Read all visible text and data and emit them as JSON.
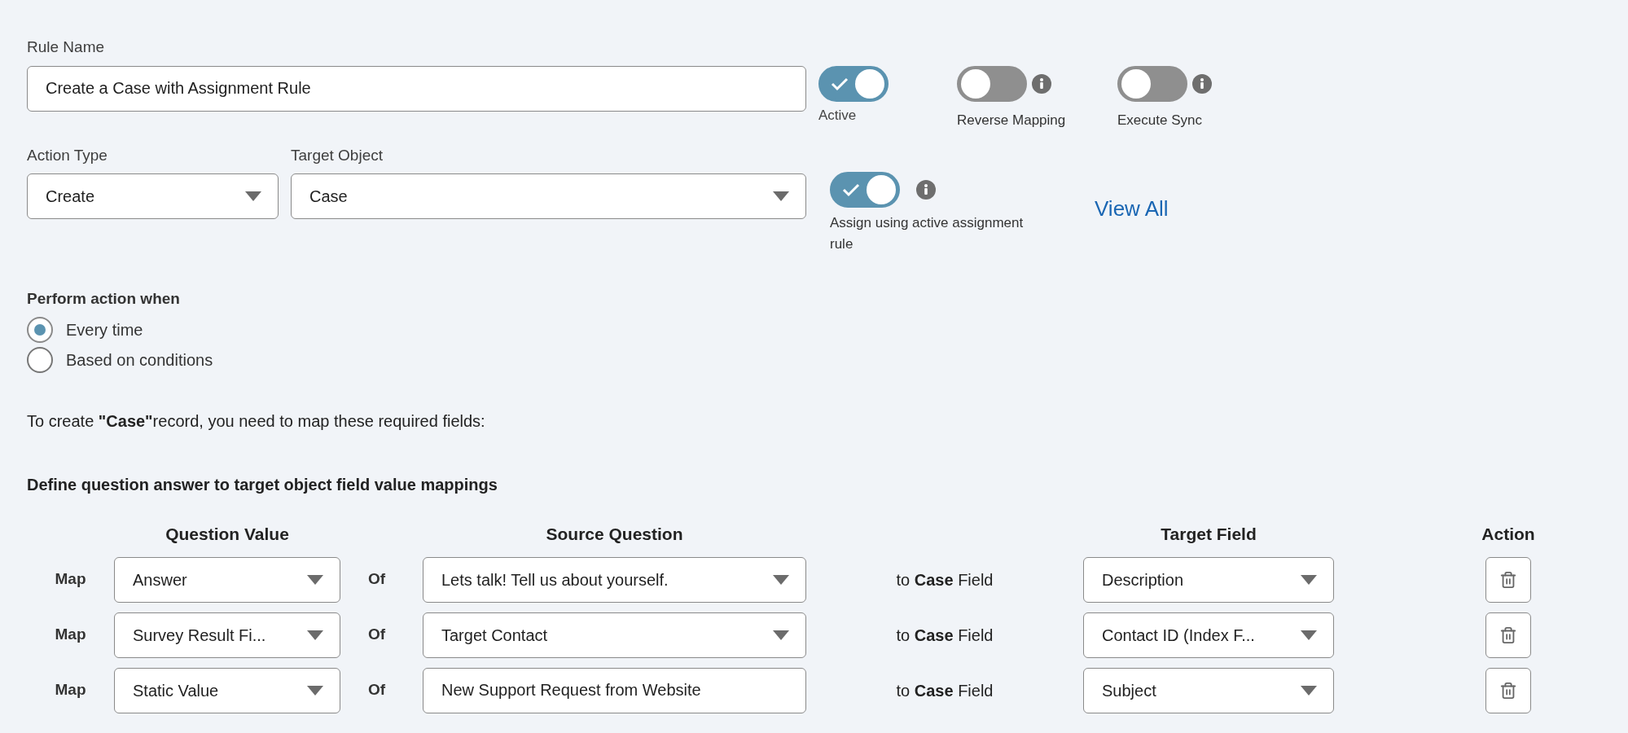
{
  "rule_name": {
    "label": "Rule Name",
    "value": "Create a Case with Assignment Rule"
  },
  "toggles": [
    {
      "label": "Active",
      "on": true,
      "info": false
    },
    {
      "label": "Reverse Mapping",
      "on": false,
      "info": true
    },
    {
      "label": "Execute Sync",
      "on": false,
      "info": true
    }
  ],
  "action_type": {
    "label": "Action Type",
    "value": "Create"
  },
  "target_object": {
    "label": "Target Object",
    "value": "Case"
  },
  "assign_toggle": {
    "label": "Assign using active assignment rule",
    "on": true,
    "info": true
  },
  "view_all_link": "View All",
  "perform_action": {
    "title": "Perform action when",
    "options": [
      {
        "label": "Every time",
        "selected": true
      },
      {
        "label": "Based on conditions",
        "selected": false
      }
    ]
  },
  "requirement_note": "To create **\"Case\"**record, you need to map these required fields:",
  "mappings": {
    "title": "Define question answer to target object field value mappings",
    "columns": [
      "Question Value",
      "Source Question",
      "Target Field",
      "Action"
    ],
    "rows": [
      {
        "map_label": "Map",
        "question_value": "Answer",
        "of_label": "Of",
        "source_question": {
          "kind": "select",
          "value": "Lets talk! Tell us about yourself."
        },
        "target_label": "to **Case** Field",
        "target_field": "Description"
      },
      {
        "map_label": "Map",
        "question_value": "Survey Result Fi...",
        "of_label": "Of",
        "source_question": {
          "kind": "select",
          "value": "Target Contact"
        },
        "target_label": "to **Case** Field",
        "target_field": "Contact ID (Index F..."
      },
      {
        "map_label": "Map",
        "question_value": "Static Value",
        "of_label": "Of",
        "source_question": {
          "kind": "text",
          "value": "New Support Request from Website"
        },
        "target_label": "to **Case** Field",
        "target_field": "Subject"
      }
    ]
  }
}
